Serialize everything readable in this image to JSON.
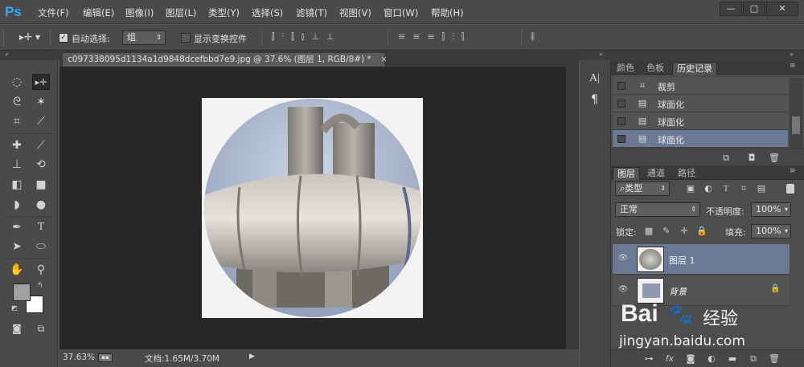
{
  "app": {
    "logo": "Ps"
  },
  "menu": [
    "文件(F)",
    "编辑(E)",
    "图像(I)",
    "图层(L)",
    "类型(Y)",
    "选择(S)",
    "滤镜(T)",
    "视图(V)",
    "窗口(W)",
    "帮助(H)"
  ],
  "window_controls": {
    "minimize": "—",
    "restore": "□",
    "close": "✕"
  },
  "options": {
    "auto_select_label": "自动选择:",
    "auto_select_checked": true,
    "auto_select_value": "组",
    "transform_label": "显示变换控件",
    "transform_checked": false
  },
  "document": {
    "tab_title": "c097338095d1134a1d9848dcefbbd7e9.jpg @ 37.6% (图层 1, RGB/8#) *",
    "close": "×",
    "zoom": "37.63%",
    "doc_info": "文档:1.65M/3.70M"
  },
  "panels": {
    "top_tabs": [
      "颜色",
      "色板",
      "历史记录"
    ],
    "top_active": "历史记录",
    "history": [
      {
        "label": "裁剪",
        "icon": "crop-icon"
      },
      {
        "label": "球面化",
        "icon": "document-icon"
      },
      {
        "label": "球面化",
        "icon": "document-icon"
      },
      {
        "label": "球面化",
        "icon": "document-icon",
        "selected": true
      }
    ],
    "layers_tabs": [
      "图层",
      "通道",
      "路径"
    ],
    "layers_active": "图层",
    "filter_kind": "类型",
    "blend_mode": "正常",
    "opacity_label": "不透明度:",
    "opacity_value": "100%",
    "lock_label": "锁定:",
    "fill_label": "填充:",
    "fill_value": "100%",
    "layers": [
      {
        "name": "图层 1",
        "selected": true
      },
      {
        "name": "背景",
        "locked": true
      }
    ],
    "watermark_line1": "Bai",
    "watermark_brand": "经验",
    "watermark_url": "jingyan.baidu.com"
  },
  "colors": {
    "accent": "#31a8ff",
    "selection": "#6a7a94",
    "foreground": "#a0a0a0",
    "background": "#ffffff"
  }
}
